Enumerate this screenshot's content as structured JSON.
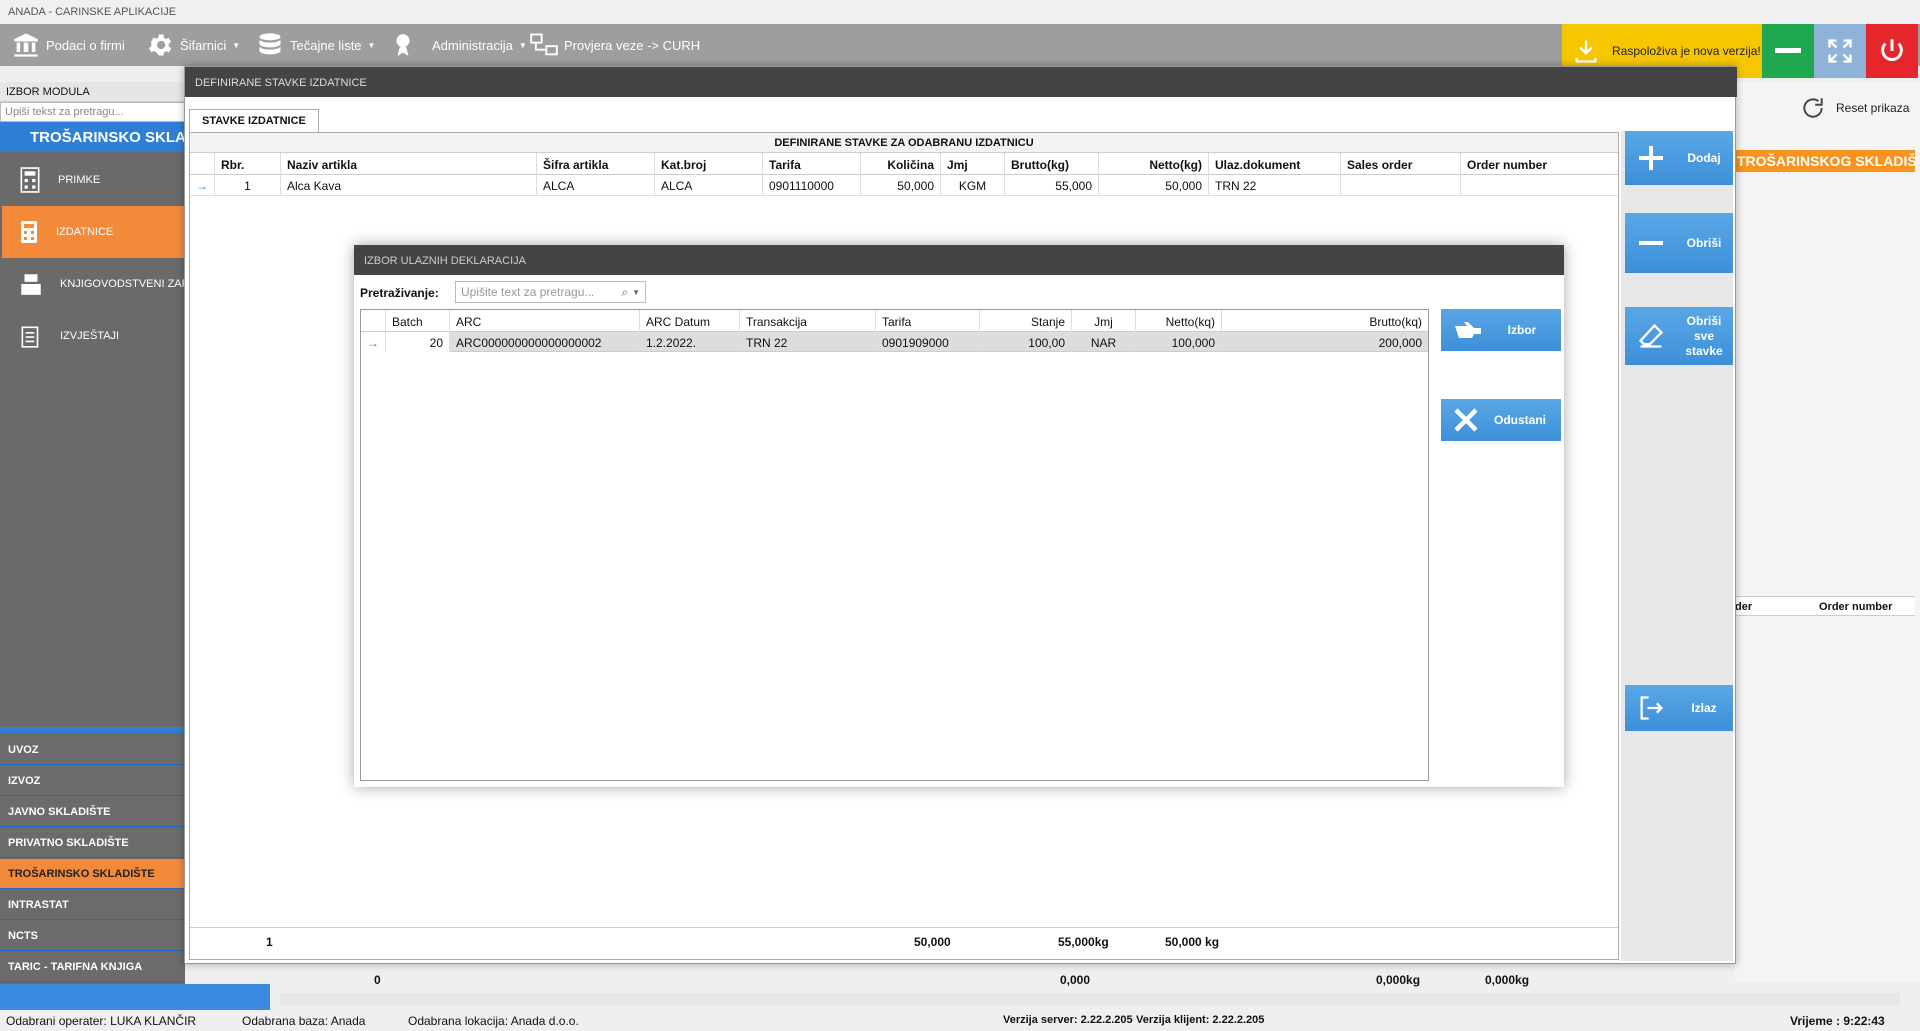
{
  "app_title": "ANADA - CARINSKE APLIKACIJE",
  "topmenu": {
    "items": [
      {
        "label": "Podaci o firmi",
        "icon": "bank-icon"
      },
      {
        "label": "Šifarnici",
        "icon": "gear-icon"
      },
      {
        "label": "Tečajne liste",
        "icon": "database-icon"
      },
      {
        "label": "Administracija",
        "icon": "award-icon"
      },
      {
        "label": "Provjera veze -> CURH",
        "icon": "network-icon"
      }
    ],
    "update": "Raspoloživa je nova verzija!"
  },
  "colors": {
    "accent": "#2f7fd6",
    "orange": "#f28a3a",
    "update": "#f6c600",
    "close": "#e6262d",
    "minimize": "#1fa84f",
    "maximize": "#8fb2d8"
  },
  "left": {
    "header": "IZBOR MODULA",
    "search_placeholder": "Upiši tekst za pretragu...",
    "module_title": "TROŠARINSKO SKLADIŠTE",
    "items": [
      "PRIMKE",
      "IZDATNICE",
      "KNJIGOVODSTVENI ZAPISI",
      "IZVJEŠTAJI"
    ],
    "nav": [
      "UVOZ",
      "IZVOZ",
      "JAVNO SKLADIŠTE",
      "PRIVATNO SKLADIŠTE",
      "TROŠARINSKO SKLADIŠTE",
      "INTRASTAT",
      "NCTS",
      "TARIC - TARIFNA KNJIGA"
    ]
  },
  "bg": {
    "reset": "Reset prikaza",
    "orange_strip": "TROŠARINSKOG SKLADIŠTA",
    "right_headers": [
      "der",
      "Order number"
    ],
    "totals": [
      "0",
      "0,000",
      "0,000kg",
      "0,000kg"
    ]
  },
  "dialog": {
    "title": "DEFINIRANE STAVKE IZDATNICE",
    "tab": "STAVKE IZDATNICE",
    "caption": "DEFINIRANE STAVKE ZA ODABRANU IZDATNICU",
    "columns": [
      "Rbr.",
      "Naziv artikla",
      "Šifra artikla",
      "Kat.broj",
      "Tarifa",
      "Količina",
      "Jmj",
      "Brutto(kg)",
      "Netto(kg)",
      "Ulaz.dokument",
      "Sales order",
      "Order number"
    ],
    "row": [
      "1",
      "Alca Kava",
      "ALCA",
      "ALCA",
      "0901110000",
      "50,000",
      "KGM",
      "55,000",
      "50,000",
      "TRN 22",
      "",
      ""
    ],
    "totals": [
      "1",
      "50,000",
      "55,000kg",
      "50,000 kg"
    ],
    "buttons": {
      "add": "Dodaj",
      "delete": "Obriši",
      "delete_all": "Obriši sve stavke",
      "exit": "Izlaz"
    }
  },
  "inner": {
    "title": "IZBOR ULAZNIH DEKLARACIJA",
    "search_label": "Pretraživanje:",
    "search_placeholder": "Upišite text za pretragu...",
    "columns": [
      "Batch",
      "ARC",
      "ARC Datum",
      "Transakcija",
      "Tarifa",
      "Stanje",
      "Jmj",
      "Netto(kq)",
      "Brutto(kq)"
    ],
    "row": [
      "20",
      "ARC000000000000000002",
      "1.2.2022.",
      "TRN 22",
      "0901909000",
      "100,00",
      "NAR",
      "100,000",
      "200,000"
    ],
    "buttons": {
      "select": "Izbor",
      "cancel": "Odustani"
    }
  },
  "status": {
    "operator": "Odabrani operater: LUKA KLANČIR",
    "db": "Odabrana baza: Anada",
    "location": "Odabrana lokacija: Anada d.o.o.",
    "server": "Verzija server: 2.22.2.205",
    "client": "Verzija klijent: 2.22.2.205",
    "time": "Vrijeme : 9:22:43"
  }
}
